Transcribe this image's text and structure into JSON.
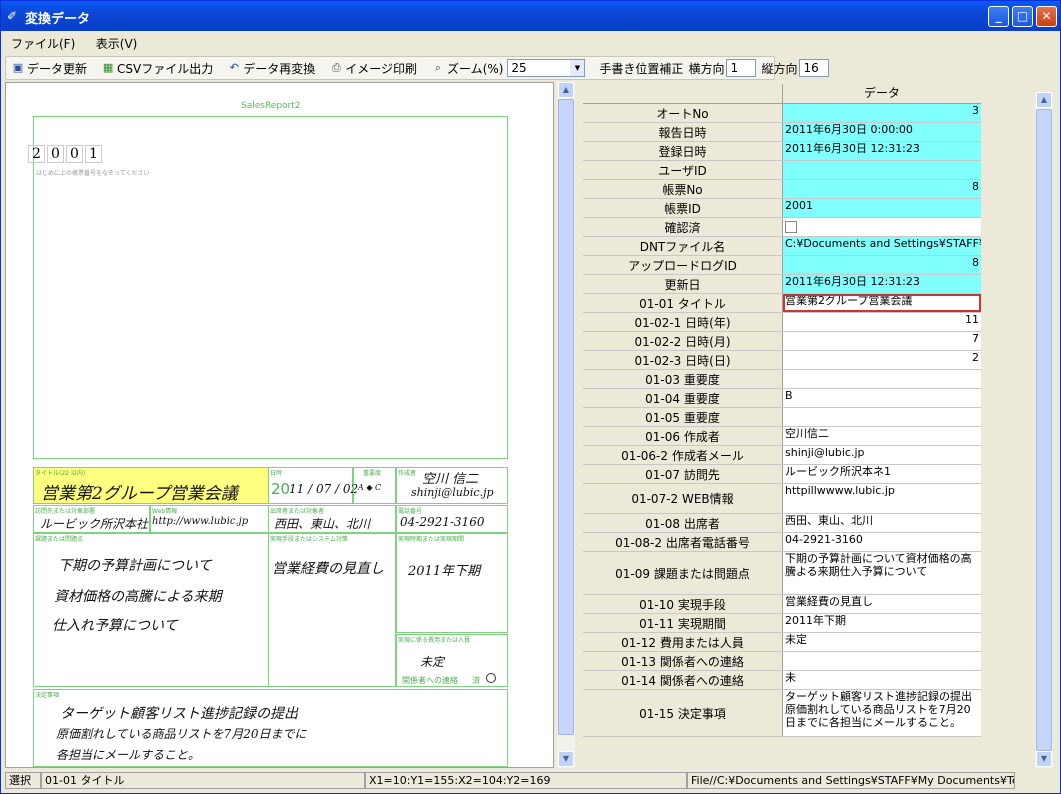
{
  "window": {
    "title": "変換データ"
  },
  "menu": {
    "file": "ファイル(F)",
    "view": "表示(V)"
  },
  "toolbar": {
    "refresh": "データ更新",
    "csv": "CSVファイル出力",
    "reconvert": "データ再変換",
    "print": "イメージ印刷",
    "zoom_label": "ズーム(%)",
    "zoom_value": "25",
    "correction_label": "手書き位置補正",
    "horizontal_label": "横方向",
    "horizontal_value": "1",
    "vertical_label": "縦方向",
    "vertical_value": "16"
  },
  "form": {
    "title": "SalesReport2",
    "digits": [
      "2",
      "0",
      "0",
      "1"
    ],
    "digit_hint": "はじめに上の帳票番号をなぞってください",
    "labels": {
      "title_field": "タイトル(22 以内)",
      "date": "日時",
      "importance": "重要度",
      "author": "作成者",
      "visit": "訪問先または対象部署",
      "web": "Web情報",
      "attendees": "出席者または対象者",
      "phone": "電話番号",
      "issue": "課題または問題点",
      "method": "実現手段またはシステム対策",
      "period": "実現時期または実現期間",
      "cost": "実現に係る費用または人員",
      "contact": "関係者への連絡",
      "contact_done": "済",
      "decision": "決定事項"
    },
    "hw": {
      "title": "営業第2グループ営業会議",
      "date_prefix": "20",
      "date": "11 / 07 / 02",
      "importance": "A ◆ C",
      "author": "空川 信二",
      "email": "shinji@lubic.jp",
      "visit": "ルービック所沢本社",
      "web": "http://www.lubic.jp",
      "attendees": "西田、東山、北川",
      "phone": "04-2921-3160",
      "issue_1": "下期の予算計画について",
      "issue_2": "資材価格の高騰による来期",
      "issue_3": "仕入れ予算について",
      "method": "営業経費の見直し",
      "period": "2011年下期",
      "cost": "未定",
      "decision_1": "ターゲット顧客リスト進捗記録の提出",
      "decision_2": "原価割れしている商品リストを7月20日までに",
      "decision_3": "各担当にメールすること。"
    }
  },
  "grid": {
    "header": "データ",
    "rows": [
      {
        "label": "オートNo",
        "value": "3",
        "style": "cyan right"
      },
      {
        "label": "報告日時",
        "value": "2011年6月30日  0:00:00",
        "style": "cyan"
      },
      {
        "label": "登録日時",
        "value": "2011年6月30日  12:31:23",
        "style": "cyan"
      },
      {
        "label": "ユーザID",
        "value": "",
        "style": "cyan"
      },
      {
        "label": "帳票No",
        "value": "8",
        "style": "cyan right"
      },
      {
        "label": "帳票ID",
        "value": "2001",
        "style": "cyan"
      },
      {
        "label": "確認済",
        "value": "",
        "style": "check"
      },
      {
        "label": "DNTファイル名",
        "value": "C:¥Documents and Settings¥STAFF¥M",
        "style": "cyan"
      },
      {
        "label": "アップロードログID",
        "value": "8",
        "style": "cyan right"
      },
      {
        "label": "更新日",
        "value": "2011年6月30日  12:31:23",
        "style": "cyan"
      },
      {
        "label": "01-01  タイトル",
        "value": "営業第2グループ営業会議",
        "style": "sel"
      },
      {
        "label": "01-02-1  日時(年)",
        "value": "11",
        "style": "right"
      },
      {
        "label": "01-02-2  日時(月)",
        "value": "7",
        "style": "right"
      },
      {
        "label": "01-02-3  日時(日)",
        "value": "2",
        "style": "right"
      },
      {
        "label": "01-03  重要度",
        "value": "",
        "style": ""
      },
      {
        "label": "01-04  重要度",
        "value": "B",
        "style": ""
      },
      {
        "label": "01-05  重要度",
        "value": "",
        "style": ""
      },
      {
        "label": "01-06  作成者",
        "value": "空川信二",
        "style": ""
      },
      {
        "label": "01-06-2  作成者メール",
        "value": "shinji@lubic.jp",
        "style": ""
      },
      {
        "label": "01-07  訪問先",
        "value": "ルービック所沢本ネ1",
        "style": ""
      },
      {
        "label": "01-07-2  WEB情報",
        "value": "httpillwwww.lubic.jp",
        "style": "tall"
      },
      {
        "label": "01-08  出席者",
        "value": "西田、東山、北川",
        "style": ""
      },
      {
        "label": "01-08-2  出席者電話番号",
        "value": "04-2921-3160",
        "style": ""
      },
      {
        "label": "01-09  課題または問題点",
        "value": "下期の予算計画について資材価格の高騰よる来期仕入予算について",
        "style": "wrap taller"
      },
      {
        "label": "01-10  実現手段",
        "value": "営業経費の見直し",
        "style": ""
      },
      {
        "label": "01-11  実現期間",
        "value": "2011年下期",
        "style": ""
      },
      {
        "label": "01-12  費用または人員",
        "value": "未定",
        "style": ""
      },
      {
        "label": "01-13  関係者への連絡",
        "value": "",
        "style": ""
      },
      {
        "label": "01-14  関係者への連絡",
        "value": "未",
        "style": ""
      },
      {
        "label": "01-15  決定事項",
        "value": "ターゲット顧客リスト進捗記録の提出原価割れしている商品リストを7月20日までに各担当にメールすること。",
        "style": "wrap tallest"
      }
    ]
  },
  "status": {
    "mode": "選択",
    "field": "01-01  タイトル",
    "coords": "X1=10:Y1=155:X2=104:Y2=169",
    "file": "File//C:¥Documents and Settings¥STAFF¥My Documents¥Teg"
  }
}
